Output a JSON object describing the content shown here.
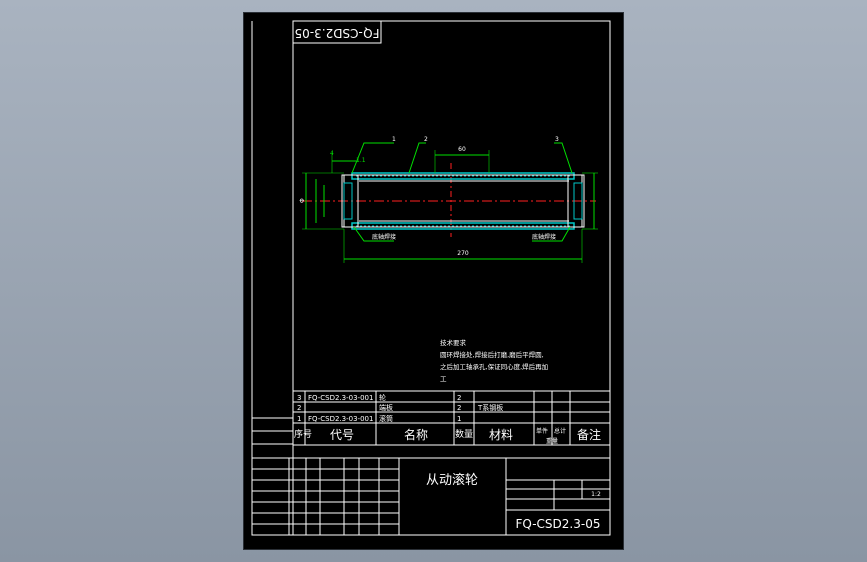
{
  "drawing": {
    "code_box": "FQ-CSD2.3-05",
    "tech_req": {
      "title": "技术要求",
      "lines": [
        "圆环焊接处,焊接后打磨,磨后平焊圆,",
        "之后加工轴承孔,保证同心度,焊后再加",
        "工"
      ]
    },
    "dims": {
      "d60": "60",
      "d270": "270",
      "leader1": "1",
      "leader2": "2",
      "leader3": "3",
      "left_dim_top": "4",
      "left_dim_mid": "1.1",
      "weld_left": "底轴焊接",
      "weld_right": "底轴焊接"
    },
    "bom": {
      "rows": [
        {
          "seq": "3",
          "code": "FQ-CSD2.3-03-001",
          "name": "轮",
          "qty": "2",
          "material": ""
        },
        {
          "seq": "2",
          "code": "",
          "name": "端板",
          "qty": "2",
          "material": "T系钢板"
        },
        {
          "seq": "1",
          "code": "FQ-CSD2.3-03-001",
          "name": "滚筒",
          "qty": "1",
          "material": ""
        }
      ],
      "header": {
        "seq": "序号",
        "code": "代号",
        "name": "名称",
        "qty": "数量",
        "material": "材料",
        "unit": "单件",
        "total": "总计",
        "weight": "重量",
        "note": "备注"
      }
    },
    "title_block": {
      "part_name": "从动滚轮",
      "drawing_no": "FQ-CSD2.3-05",
      "scale": "1:2"
    }
  }
}
